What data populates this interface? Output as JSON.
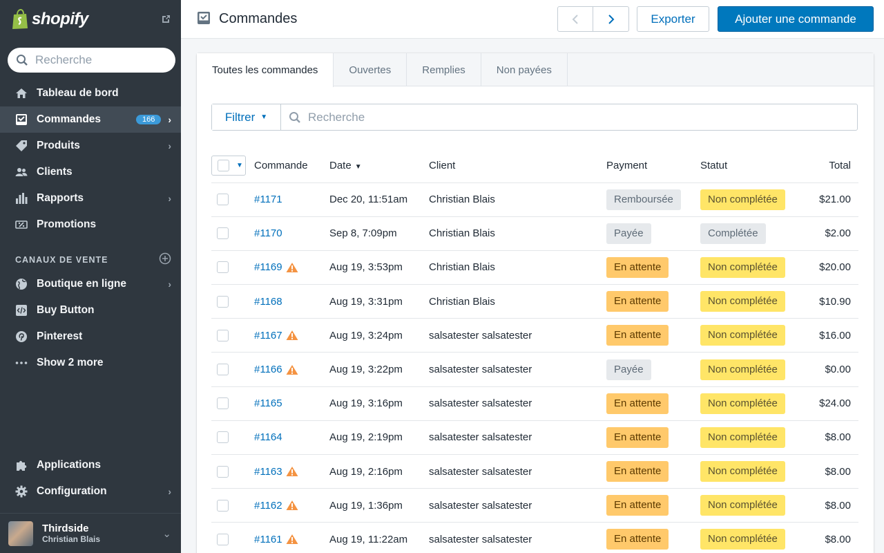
{
  "app": {
    "brand": "shopify"
  },
  "sidebar": {
    "search_placeholder": "Recherche",
    "items": [
      {
        "label": "Tableau de bord",
        "icon": "home-icon"
      },
      {
        "label": "Commandes",
        "icon": "orders-icon",
        "badge": "166",
        "active": true
      },
      {
        "label": "Produits",
        "icon": "tag-icon"
      },
      {
        "label": "Clients",
        "icon": "customers-icon"
      },
      {
        "label": "Rapports",
        "icon": "bar-chart-icon"
      },
      {
        "label": "Promotions",
        "icon": "discount-icon"
      }
    ],
    "sales_channels_heading": "CANAUX DE VENTE",
    "channels": [
      {
        "label": "Boutique en ligne",
        "icon": "globe-icon"
      },
      {
        "label": "Buy Button",
        "icon": "code-icon"
      },
      {
        "label": "Pinterest",
        "icon": "pinterest-icon"
      },
      {
        "label": "Show 2 more",
        "icon": "more-icon"
      }
    ],
    "bottom": [
      {
        "label": "Applications",
        "icon": "puzzle-icon"
      },
      {
        "label": "Configuration",
        "icon": "gear-icon"
      }
    ],
    "account": {
      "shop": "Thirdside",
      "user": "Christian Blais"
    }
  },
  "header": {
    "title": "Commandes",
    "export_label": "Exporter",
    "add_label": "Ajouter une commande"
  },
  "tabs": [
    "Toutes les commandes",
    "Ouvertes",
    "Remplies",
    "Non payées"
  ],
  "filter": {
    "label": "Filtrer",
    "search_placeholder": "Recherche"
  },
  "table": {
    "headers": {
      "order": "Commande",
      "date": "Date",
      "client": "Client",
      "payment": "Payment",
      "status": "Statut",
      "total": "Total"
    },
    "rows": [
      {
        "order": "#1171",
        "warn": false,
        "date": "Dec 20, 11:51am",
        "client": "Christian Blais",
        "payment": "Remboursée",
        "payment_style": "grey",
        "status": "Non complétée",
        "status_style": "yellow",
        "total": "$21.00"
      },
      {
        "order": "#1170",
        "warn": false,
        "date": "Sep 8, 7:09pm",
        "client": "Christian Blais",
        "payment": "Payée",
        "payment_style": "grey",
        "status": "Complétée",
        "status_style": "grey",
        "total": "$2.00"
      },
      {
        "order": "#1169",
        "warn": true,
        "date": "Aug 19, 3:53pm",
        "client": "Christian Blais",
        "payment": "En attente",
        "payment_style": "orange",
        "status": "Non complétée",
        "status_style": "yellow",
        "total": "$20.00"
      },
      {
        "order": "#1168",
        "warn": false,
        "date": "Aug 19, 3:31pm",
        "client": "Christian Blais",
        "payment": "En attente",
        "payment_style": "orange",
        "status": "Non complétée",
        "status_style": "yellow",
        "total": "$10.90"
      },
      {
        "order": "#1167",
        "warn": true,
        "date": "Aug 19, 3:24pm",
        "client": "salsatester salsatester",
        "payment": "En attente",
        "payment_style": "orange",
        "status": "Non complétée",
        "status_style": "yellow",
        "total": "$16.00"
      },
      {
        "order": "#1166",
        "warn": true,
        "date": "Aug 19, 3:22pm",
        "client": "salsatester salsatester",
        "payment": "Payée",
        "payment_style": "grey",
        "status": "Non complétée",
        "status_style": "yellow",
        "total": "$0.00"
      },
      {
        "order": "#1165",
        "warn": false,
        "date": "Aug 19, 3:16pm",
        "client": "salsatester salsatester",
        "payment": "En attente",
        "payment_style": "orange",
        "status": "Non complétée",
        "status_style": "yellow",
        "total": "$24.00"
      },
      {
        "order": "#1164",
        "warn": false,
        "date": "Aug 19, 2:19pm",
        "client": "salsatester salsatester",
        "payment": "En attente",
        "payment_style": "orange",
        "status": "Non complétée",
        "status_style": "yellow",
        "total": "$8.00"
      },
      {
        "order": "#1163",
        "warn": true,
        "date": "Aug 19, 2:16pm",
        "client": "salsatester salsatester",
        "payment": "En attente",
        "payment_style": "orange",
        "status": "Non complétée",
        "status_style": "yellow",
        "total": "$8.00"
      },
      {
        "order": "#1162",
        "warn": true,
        "date": "Aug 19, 1:36pm",
        "client": "salsatester salsatester",
        "payment": "En attente",
        "payment_style": "orange",
        "status": "Non complétée",
        "status_style": "yellow",
        "total": "$8.00"
      },
      {
        "order": "#1161",
        "warn": true,
        "date": "Aug 19, 11:22am",
        "client": "salsatester salsatester",
        "payment": "En attente",
        "payment_style": "orange",
        "status": "Non complétée",
        "status_style": "yellow",
        "total": "$8.00"
      }
    ]
  },
  "colors": {
    "sidebar_bg": "#2f373f",
    "primary": "#0078bd",
    "link": "#006fbb",
    "badge": "#3b9ad9",
    "warning": "#f49342"
  }
}
